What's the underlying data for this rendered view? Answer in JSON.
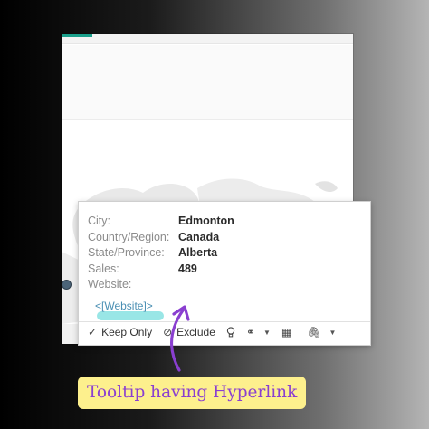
{
  "tooltip": {
    "rows": [
      {
        "label": "City:",
        "value": "Edmonton"
      },
      {
        "label": "Country/Region:",
        "value": "Canada"
      },
      {
        "label": "State/Province:",
        "value": "Alberta"
      },
      {
        "label": "Sales:",
        "value": "489"
      },
      {
        "label": "Website:",
        "value": ""
      }
    ],
    "link_text": "<[Website]>",
    "actions": {
      "keep_only": "Keep Only",
      "exclude": "Exclude"
    }
  },
  "icons": [
    "check-icon",
    "exclude-icon",
    "lightbulb-icon",
    "group-icon",
    "table-grid-icon",
    "paperclip-icon",
    "dropdown-caret-icon"
  ],
  "caption": "Tooltip having Hyperlink",
  "colors": {
    "caption_bg": "#fdf08d",
    "caption_text": "#8a3fd0",
    "link": "#4a8fb3",
    "highlight": "#7fe0e0",
    "arrow": "#8a3fd0"
  }
}
